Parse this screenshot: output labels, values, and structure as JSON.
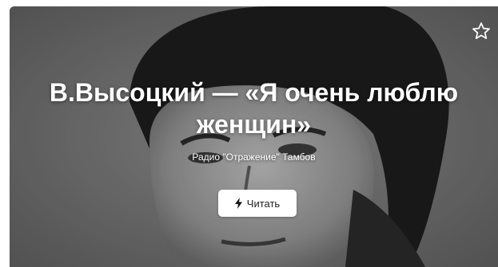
{
  "card": {
    "title": "В.Высоцкий — «Я очень люблю женщин»",
    "source": "Радио \"Отражение\" Тамбов",
    "read_button_label": "Читать",
    "icons": {
      "favorite": "star-outline-icon",
      "read": "lightning-bolt-icon"
    }
  }
}
